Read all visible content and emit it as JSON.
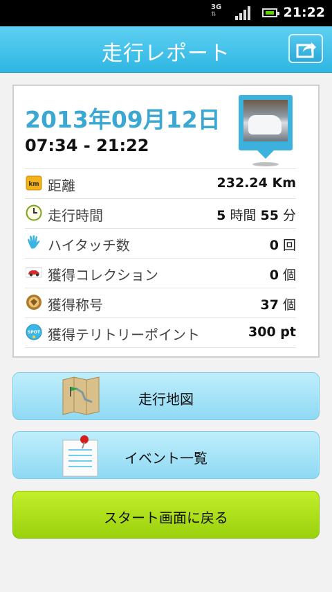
{
  "status_bar": {
    "network": "3G",
    "time": "21:22"
  },
  "header": {
    "title": "走行レポート",
    "share_icon": "share-icon"
  },
  "report": {
    "date": "2013年09月12日",
    "time_range": "07:34 - 21:22",
    "photo_icon": "car-photo",
    "rows": [
      {
        "icon": "km-icon",
        "label": "距離",
        "value": "232.24 Km"
      },
      {
        "icon": "clock-icon",
        "label": "走行時間",
        "value_parts": [
          "5",
          " 時間 ",
          "55",
          " 分"
        ]
      },
      {
        "icon": "hand-icon",
        "label": "ハイタッチ数",
        "value_parts": [
          "0",
          " 回"
        ]
      },
      {
        "icon": "car-icon",
        "label": "獲得コレクション",
        "value_parts": [
          "0",
          " 個"
        ]
      },
      {
        "icon": "medal-icon",
        "label": "獲得称号",
        "value_parts": [
          "37",
          " 個"
        ]
      },
      {
        "icon": "spot-icon",
        "icon_text": "SPOT",
        "label": "獲得テリトリーポイント",
        "value": "300 pt"
      }
    ]
  },
  "buttons": {
    "map": "走行地図",
    "events": "イベント一覧",
    "back": "スタート画面に戻る"
  },
  "colors": {
    "header": "#2eb6e3",
    "date": "#3aa8d2",
    "back_button": "#b3e31a"
  }
}
